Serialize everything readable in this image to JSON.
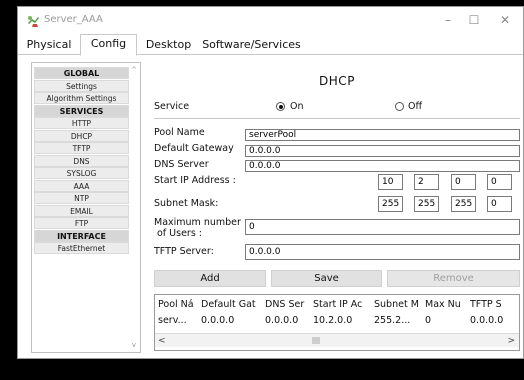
{
  "window": {
    "title": "Server_AAA",
    "minimize_glyph": "–",
    "maximize_glyph": "☐",
    "close_glyph": "✕"
  },
  "tabs": [
    {
      "label": "Physical",
      "active": false
    },
    {
      "label": "Config",
      "active": true
    },
    {
      "label": "Desktop",
      "active": false
    },
    {
      "label": "Software/Services",
      "active": false
    }
  ],
  "nav": {
    "items": [
      {
        "label": "GLOBAL",
        "header": true
      },
      {
        "label": "Settings",
        "header": false
      },
      {
        "label": "Algorithm Settings",
        "header": false
      },
      {
        "label": "SERVICES",
        "header": true
      },
      {
        "label": "HTTP",
        "header": false
      },
      {
        "label": "DHCP",
        "header": false
      },
      {
        "label": "TFTP",
        "header": false
      },
      {
        "label": "DNS",
        "header": false
      },
      {
        "label": "SYSLOG",
        "header": false
      },
      {
        "label": "AAA",
        "header": false
      },
      {
        "label": "NTP",
        "header": false
      },
      {
        "label": "EMAIL",
        "header": false
      },
      {
        "label": "FTP",
        "header": false
      },
      {
        "label": "INTERFACE",
        "header": true
      },
      {
        "label": "FastEthernet",
        "header": false
      }
    ]
  },
  "dhcp": {
    "heading": "DHCP",
    "service_label": "Service",
    "on_label": "On",
    "off_label": "Off",
    "service_on": true,
    "pool_name_label": "Pool Name",
    "pool_name": "serverPool",
    "gateway_label": "Default Gateway",
    "gateway": "0.0.0.0",
    "dns_label": "DNS Server",
    "dns": "0.0.0.0",
    "start_ip_label": "Start IP Address :",
    "start_ip": [
      "10",
      "2",
      "0",
      "0"
    ],
    "mask_label": "Subnet Mask:",
    "mask": [
      "255",
      "255",
      "255",
      "0"
    ],
    "max_users_label_1": "Maximum number",
    "max_users_label_2": "of Users :",
    "max_users": "0",
    "tftp_label": "TFTP Server:",
    "tftp": "0.0.0.0",
    "add_label": "Add",
    "save_label": "Save",
    "remove_label": "Remove"
  },
  "pool_table": {
    "headers": [
      "Pool Ná",
      "Default Gat",
      "DNS Ser",
      "Start IP Ac",
      "Subnet M",
      "Max Nu",
      "TFTP S"
    ],
    "rows": [
      [
        "serv...",
        "0.0.0.0",
        "0.0.0.0",
        "10.2.0.0",
        "255.2...",
        "0",
        "0.0.0.0"
      ]
    ],
    "scroll_left": "<",
    "scroll_right": ">"
  }
}
